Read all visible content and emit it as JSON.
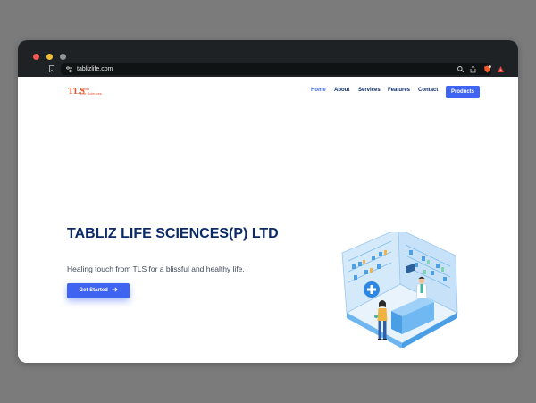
{
  "browser": {
    "url": "tablizlife.com"
  },
  "nav": {
    "logo_mark": "TLS",
    "logo_name_line1": "Tabliz",
    "logo_name_line2": "Life Sciences",
    "items": [
      {
        "label": "Home"
      },
      {
        "label": "About"
      },
      {
        "label": "Services"
      },
      {
        "label": "Features"
      },
      {
        "label": "Contact"
      }
    ],
    "products_label": "Products"
  },
  "hero": {
    "title": "TABLIZ LIFE SCIENCES(P) LTD",
    "subtitle": "Healing touch from TLS for a blissful and healthy life.",
    "cta_label": "Get Started",
    "cta_icon": "arrow-right-icon"
  },
  "colors": {
    "accent": "#3f64f1",
    "heading": "#0b2a66",
    "logo": "#e4562d"
  }
}
